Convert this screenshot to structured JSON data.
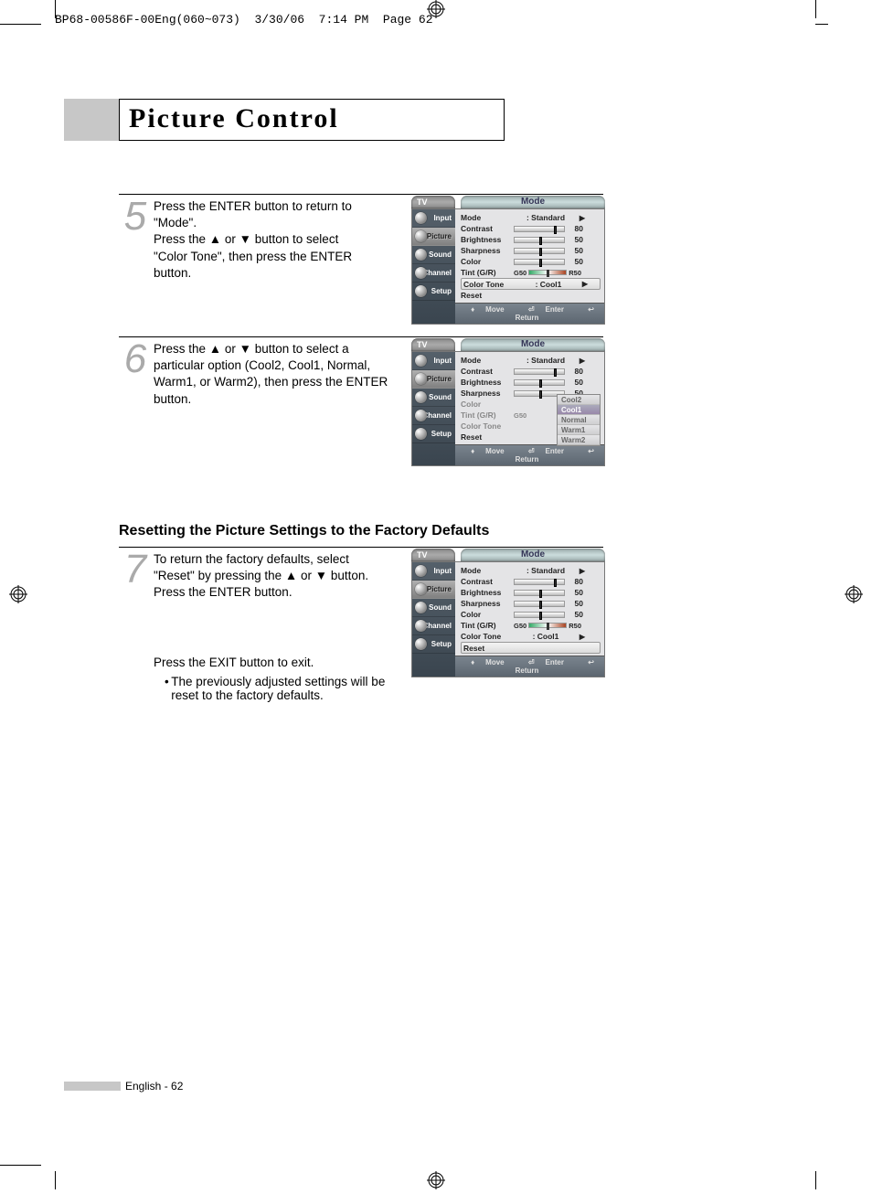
{
  "header": {
    "file": "BP68-00586F-00Eng(060~073)",
    "date": "3/30/06",
    "time": "7:14 PM",
    "page": "Page 62"
  },
  "title": "Picture Control",
  "steps": {
    "s5": {
      "num": "5",
      "text": "Press the ENTER button to return to \"Mode\".\nPress the ▲ or ▼ button to select \"Color Tone\", then press the ENTER button."
    },
    "s6": {
      "num": "6",
      "text": "Press the ▲ or ▼ button to select a particular option (Cool2, Cool1, Normal, Warm1, or Warm2), then press the ENTER button."
    },
    "s7": {
      "num": "7",
      "text1": "To return the factory defaults, select \"Reset\" by pressing the ▲ or ▼ button. Press the ENTER button.",
      "text2": "Press the EXIT button to exit.",
      "bullet": "The previously adjusted settings will be reset to the factory defaults."
    }
  },
  "subheading": "Resetting the Picture Settings to the Factory Defaults",
  "osd": {
    "tv": "TV",
    "title": "Mode",
    "side": {
      "input": "Input",
      "picture": "Picture",
      "sound": "Sound",
      "channel": "Channel",
      "setup": "Setup"
    },
    "rows": {
      "mode": "Mode",
      "mode_val": ": Standard",
      "contrast": "Contrast",
      "contrast_val": "80",
      "brightness": "Brightness",
      "brightness_val": "50",
      "sharpness": "Sharpness",
      "sharpness_val": "50",
      "color": "Color",
      "color_val": "50",
      "tint": "Tint (G/R)",
      "tint_g": "G50",
      "tint_r": "R50",
      "colortone": "Color Tone",
      "colortone_val": ": Cool1",
      "reset": "Reset"
    },
    "dropdown": {
      "cool2": "Cool2",
      "cool1": "Cool1",
      "normal": "Normal",
      "warm1": "Warm1",
      "warm2": "Warm2"
    },
    "footer": {
      "move": "Move",
      "enter": "Enter",
      "return": "Return"
    }
  },
  "footer": {
    "text": "English - 62"
  }
}
